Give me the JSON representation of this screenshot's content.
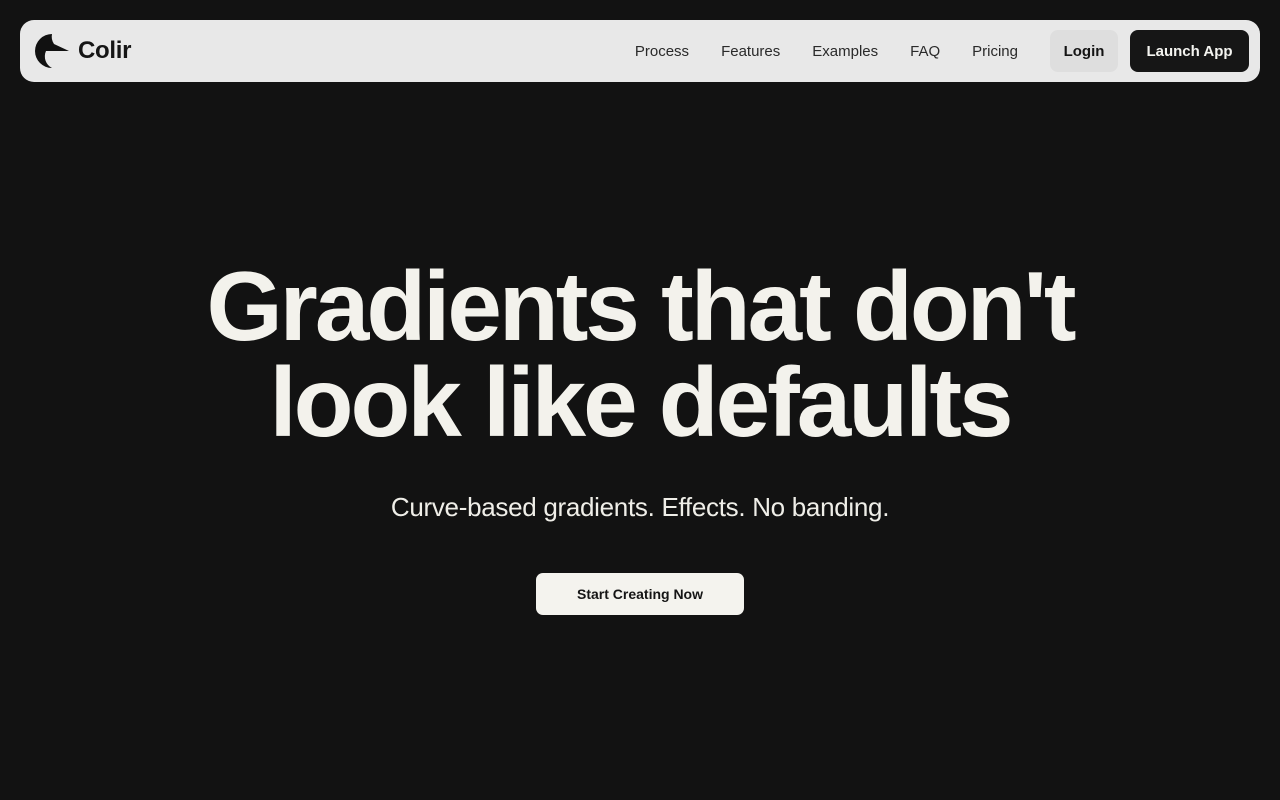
{
  "brand": {
    "name": "Colir",
    "logo_icon": "crescent-arrow-logo"
  },
  "nav": {
    "items": [
      {
        "label": "Process"
      },
      {
        "label": "Features"
      },
      {
        "label": "Examples"
      },
      {
        "label": "FAQ"
      },
      {
        "label": "Pricing"
      }
    ],
    "login_label": "Login",
    "launch_label": "Launch App"
  },
  "hero": {
    "title_line1": "Gradients that don't",
    "title_line2": "look like defaults",
    "subtitle": "Curve-based gradients. Effects. No banding.",
    "cta_label": "Start Creating Now"
  },
  "colors": {
    "background": "#121212",
    "navbar": "#e8e8e8",
    "text_light": "#f3f2ec",
    "button_dark": "#161616"
  }
}
